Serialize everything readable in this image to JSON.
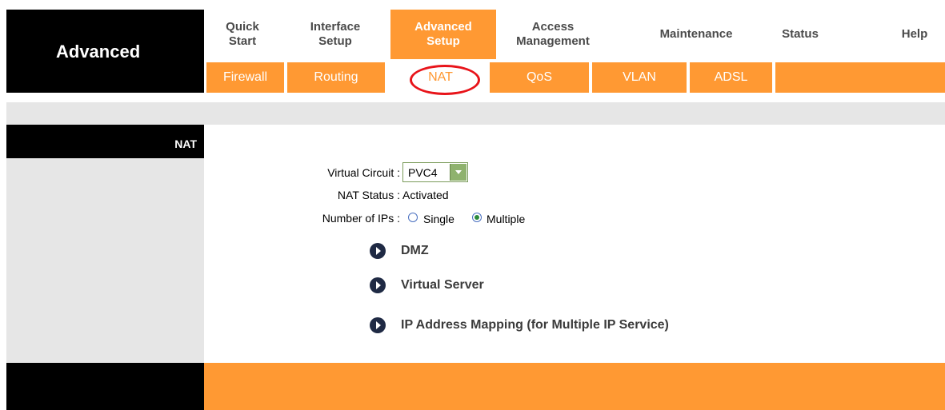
{
  "brand": {
    "title": "Advanced"
  },
  "main_nav": [
    {
      "line1": "Quick",
      "line2": "Start",
      "active": false
    },
    {
      "line1": "Interface",
      "line2": "Setup",
      "active": false
    },
    {
      "line1": "Advanced",
      "line2": "Setup",
      "active": true
    },
    {
      "line1": "Access",
      "line2": "Management",
      "active": false
    },
    {
      "line1": "Maintenance",
      "line2": "",
      "active": false
    },
    {
      "line1": "Status",
      "line2": "",
      "active": false
    },
    {
      "line1": "Help",
      "line2": "",
      "active": false
    }
  ],
  "sub_nav": [
    {
      "label": "Firewall",
      "active": false
    },
    {
      "label": "Routing",
      "active": false
    },
    {
      "label": "NAT",
      "active": true
    },
    {
      "label": "QoS",
      "active": false
    },
    {
      "label": "VLAN",
      "active": false
    },
    {
      "label": "ADSL",
      "active": false
    }
  ],
  "section": {
    "title": "NAT"
  },
  "form": {
    "virtual_circuit_label": "Virtual Circuit :",
    "virtual_circuit_value": "PVC4",
    "nat_status_label": "NAT Status :",
    "nat_status_value": "Activated",
    "number_of_ips_label": "Number of IPs :",
    "single_label": "Single",
    "multiple_label": "Multiple",
    "selected_ips": "Multiple"
  },
  "links": [
    {
      "label": "DMZ"
    },
    {
      "label": "Virtual Server"
    },
    {
      "label": "IP Address Mapping (for Multiple IP Service)"
    }
  ],
  "colors": {
    "accent": "#ff9933",
    "highlight": "#e8141a",
    "panel": "#e6e6e6"
  }
}
